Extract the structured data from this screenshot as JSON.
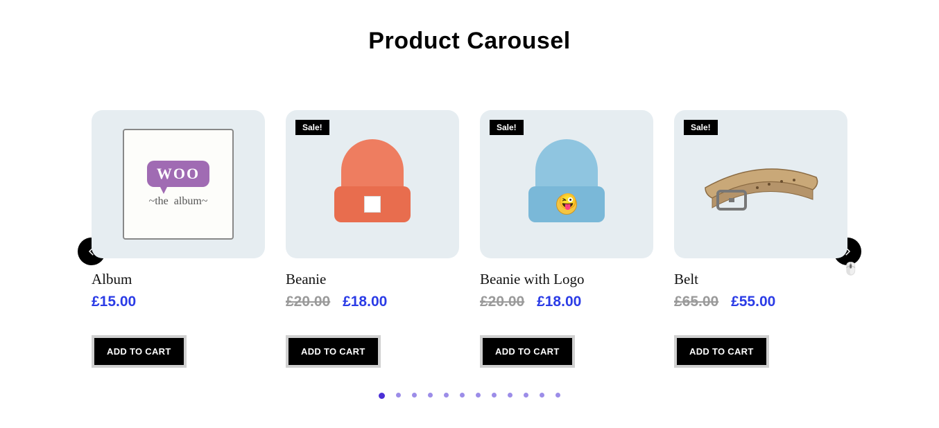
{
  "title": "Product Carousel",
  "sale_label": "Sale!",
  "add_to_cart_label": "ADD TO CART",
  "currency": "£",
  "products": [
    {
      "name": "Album",
      "on_sale": false,
      "price": "£15.00",
      "old_price": null
    },
    {
      "name": "Beanie",
      "on_sale": true,
      "price": "£18.00",
      "old_price": "£20.00"
    },
    {
      "name": "Beanie with Logo",
      "on_sale": true,
      "price": "£18.00",
      "old_price": "£20.00"
    },
    {
      "name": "Belt",
      "on_sale": true,
      "price": "£55.00",
      "old_price": "£65.00"
    }
  ],
  "pagination": {
    "total_dots": 12,
    "active_index": 0
  },
  "colors": {
    "price": "#2b3ce6",
    "old_price": "#9a9a9a",
    "dot": "#4b2fd6",
    "card_bg": "#e6edf1"
  }
}
